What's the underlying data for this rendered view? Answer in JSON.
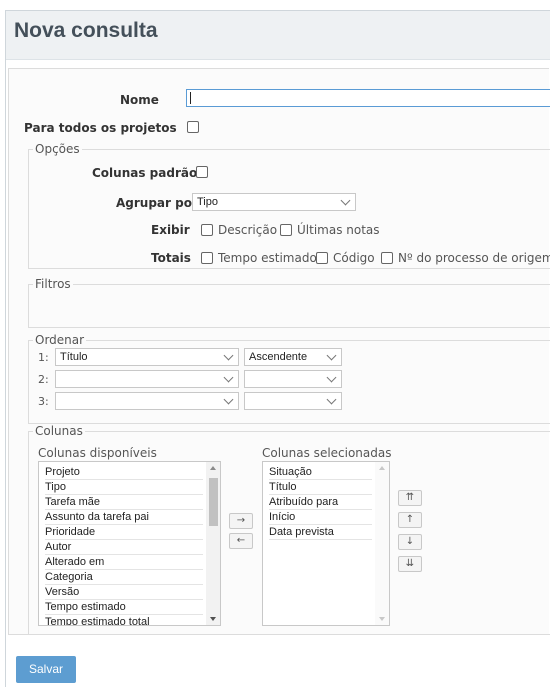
{
  "title": "Nova consulta",
  "form": {
    "name_label": "Nome",
    "name_value": "",
    "all_projects_label": "Para todos os projetos"
  },
  "options": {
    "legend": "Opções",
    "default_columns_label": "Colunas padrão",
    "group_by_label": "Agrupar por",
    "group_by_value": "Tipo",
    "show_label": "Exibir",
    "show_options": [
      "Descrição",
      "Últimas notas"
    ],
    "totals_label": "Totais",
    "totals_options": [
      "Tempo estimado",
      "Código",
      "Nº do processo de origem"
    ]
  },
  "filters": {
    "legend": "Filtros"
  },
  "sort": {
    "legend": "Ordenar",
    "rows": [
      {
        "index": "1:",
        "field": "Título",
        "direction": "Ascendente"
      },
      {
        "index": "2:",
        "field": "",
        "direction": ""
      },
      {
        "index": "3:",
        "field": "",
        "direction": ""
      }
    ]
  },
  "columns": {
    "legend": "Colunas",
    "available_label": "Colunas disponíveis",
    "available": [
      "Projeto",
      "Tipo",
      "Tarefa mãe",
      "Assunto da tarefa pai",
      "Prioridade",
      "Autor",
      "Alterado em",
      "Categoria",
      "Versão",
      "Tempo estimado",
      "Tempo estimado total"
    ],
    "selected_label": "Colunas selecionadas",
    "selected": [
      "Situação",
      "Título",
      "Atribuído para",
      "Início",
      "Data prevista"
    ],
    "move_right": "→",
    "move_left": "←",
    "move_top": "⇈",
    "move_up": "↑",
    "move_down": "↓",
    "move_bottom": "⇊"
  },
  "save_label": "Salvar"
}
